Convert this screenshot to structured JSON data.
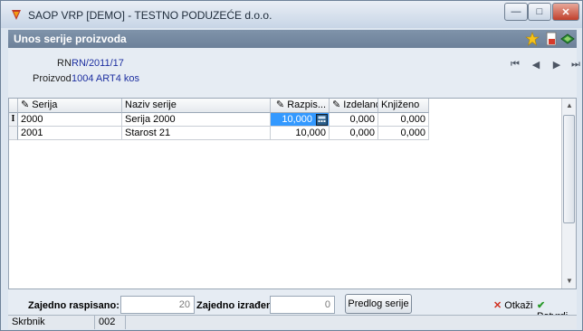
{
  "window": {
    "title": "SAOP VRP [DEMO] - TESTNO PODUZEĆE d.o.o."
  },
  "header": {
    "title": "Unos serije proizvoda"
  },
  "fields": {
    "rn_label": "RN",
    "rn_value": "RN/2011/17",
    "proizvod_label": "Proizvod",
    "proizvod_value": "1004 ART4 kos"
  },
  "grid": {
    "columns": [
      "Serija",
      "Naziv serije",
      "Razpis...",
      "Izdelano",
      "Knjiženo"
    ],
    "rows": [
      {
        "serija": "2000",
        "naziv": "Serija 2000",
        "razpis": "10,000",
        "izdelano": "0,000",
        "knjizeno": "0,000"
      },
      {
        "serija": "2001",
        "naziv": "Starost  21",
        "razpis": "10,000",
        "izdelano": "0,000",
        "knjizeno": "0,000"
      }
    ]
  },
  "bottom": {
    "raspisano_label": "Zajedno raspisano:",
    "raspisano_value": "20",
    "izradeno_label": "Zajedno izrađeno:",
    "izradeno_value": "0",
    "predlog_label": "Predlog serije",
    "otkazi_label": "Otkaži",
    "potvrdi_label": "Potvrdi"
  },
  "status": {
    "field": "Skrbnik",
    "value": "002"
  },
  "colors": {
    "accent": "#6d8199",
    "selection": "#3399ff",
    "cancel": "#d03020",
    "confirm": "#2a9a2a"
  }
}
